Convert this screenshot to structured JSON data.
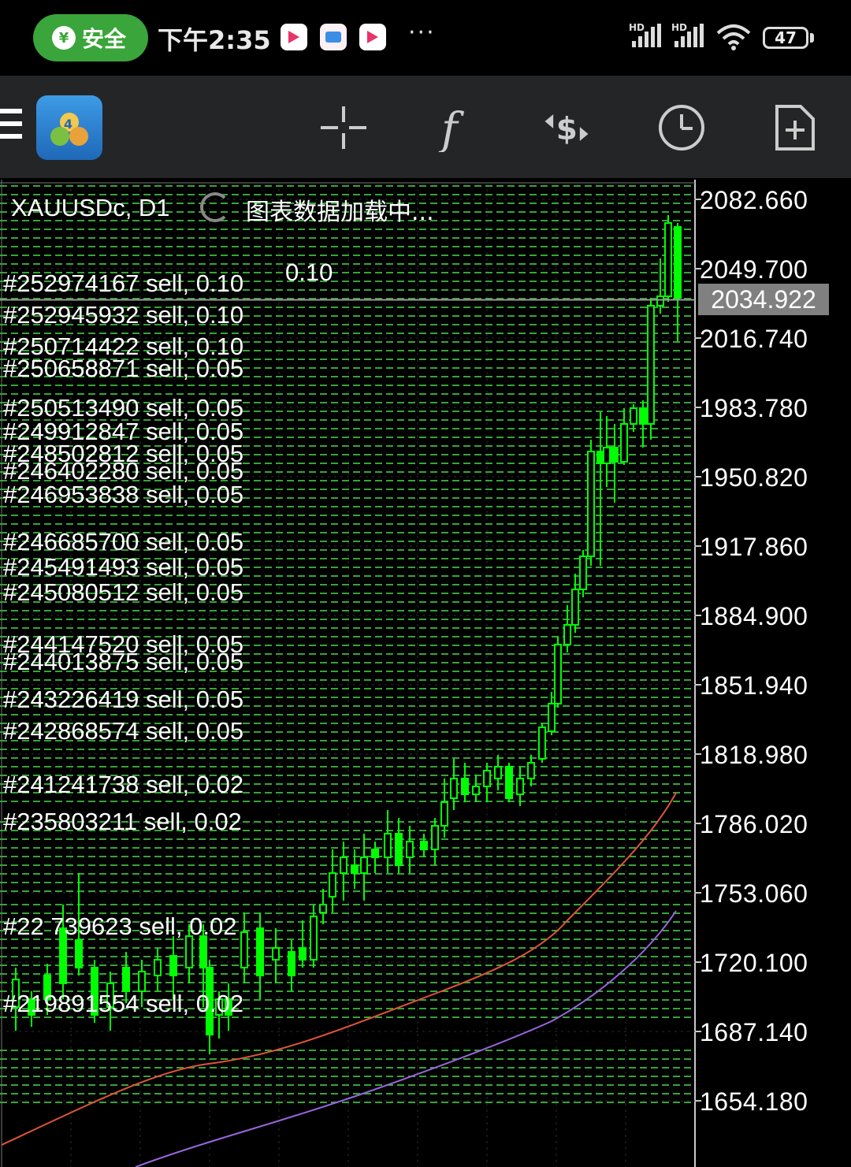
{
  "status_bar": {
    "safe_badge": "安全",
    "time": "下午2:35",
    "more": "···",
    "battery": "47",
    "app_icons": [
      "youku-icon",
      "doc-icon",
      "youku-icon"
    ]
  },
  "toolbar": {
    "icons": [
      "menu-icon",
      "mt4-logo",
      "crosshair-icon",
      "indicators-icon",
      "trade-icon",
      "timeframe-icon",
      "new-order-icon"
    ]
  },
  "chart": {
    "symbol": "XAUUSDc, D1",
    "loading_text": "图表数据加载中...",
    "current_price": "2034.922",
    "price_axis": [
      "2082.660",
      "2049.700",
      "2016.740",
      "1983.780",
      "1950.820",
      "1917.860",
      "1884.900",
      "1851.940",
      "1818.980",
      "1786.020",
      "1753.060",
      "1720.100",
      "1687.140",
      "1654.180"
    ],
    "colors": {
      "bull": "#00ff00",
      "grid": "#37a437",
      "ma_fast": "#e0553a",
      "ma_slow": "#9966dd",
      "price_line": "#9a9a9a"
    },
    "orders": [
      "#252974167 sell, 0.10",
      "#252945932 sell, 0.10",
      "#250714422 sell, 0.10",
      "#250658871 sell, 0.05",
      "#250513490 sell, 0.05",
      "#249912847 sell, 0.05",
      "#248502812 sell, 0.05",
      "#246402280 sell, 0.05",
      "#246953838 sell, 0.05",
      "#246685700 sell, 0.05",
      "#245491493 sell, 0.05",
      "#245080512 sell, 0.05",
      "#244147520 sell, 0.05",
      "#244013875 sell, 0.05",
      "#243226419 sell, 0.05",
      "#242868574 sell, 0.05",
      "#241241738 sell, 0.02",
      "#235803211 sell, 0.02",
      "#22 739623 sell, 0.02",
      "#219891554 sell, 0.02"
    ],
    "limit_label": "0.10"
  }
}
